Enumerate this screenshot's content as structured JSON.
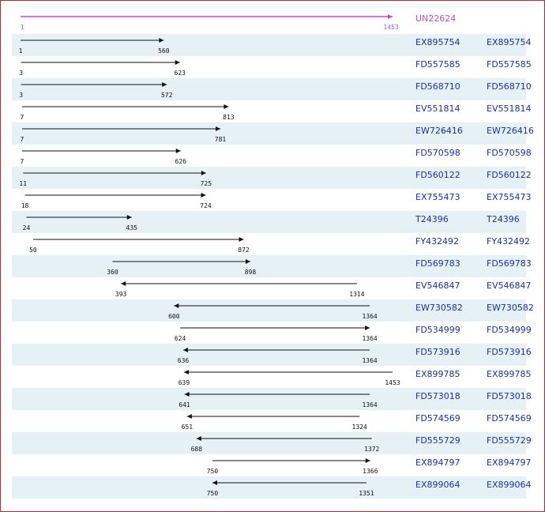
{
  "query": {
    "id": "UN22624",
    "start": 1,
    "end": 1453,
    "strand": "+"
  },
  "colors": {
    "query_line": "#c44cc4",
    "hit_line": "#111111",
    "id_text": "#1a2fb0",
    "row_band": "#e6f1f5",
    "border": "#c0272d"
  },
  "hits": [
    {
      "id": "EX895754",
      "start": 1,
      "end": 560,
      "strand": "+"
    },
    {
      "id": "FD557585",
      "start": 3,
      "end": 623,
      "strand": "+"
    },
    {
      "id": "FD568710",
      "start": 3,
      "end": 572,
      "strand": "+"
    },
    {
      "id": "EV551814",
      "start": 7,
      "end": 813,
      "strand": "+"
    },
    {
      "id": "EW726416",
      "start": 7,
      "end": 781,
      "strand": "+"
    },
    {
      "id": "FD570598",
      "start": 7,
      "end": 626,
      "strand": "+"
    },
    {
      "id": "FD560122",
      "start": 11,
      "end": 725,
      "strand": "+"
    },
    {
      "id": "EX755473",
      "start": 18,
      "end": 724,
      "strand": "+"
    },
    {
      "id": "T24396",
      "start": 24,
      "end": 435,
      "strand": "+"
    },
    {
      "id": "FY432492",
      "start": 50,
      "end": 872,
      "strand": "+"
    },
    {
      "id": "FD569783",
      "start": 360,
      "end": 898,
      "strand": "+"
    },
    {
      "id": "EV546847",
      "start": 393,
      "end": 1314,
      "strand": "-"
    },
    {
      "id": "EW730582",
      "start": 600,
      "end": 1364,
      "strand": "-"
    },
    {
      "id": "FD534999",
      "start": 624,
      "end": 1364,
      "strand": "+"
    },
    {
      "id": "FD573916",
      "start": 636,
      "end": 1364,
      "strand": "-"
    },
    {
      "id": "EX899785",
      "start": 639,
      "end": 1453,
      "strand": "-"
    },
    {
      "id": "FD573018",
      "start": 641,
      "end": 1364,
      "strand": "-"
    },
    {
      "id": "FD574569",
      "start": 651,
      "end": 1324,
      "strand": "-"
    },
    {
      "id": "FD555729",
      "start": 688,
      "end": 1372,
      "strand": "-"
    },
    {
      "id": "EX894797",
      "start": 750,
      "end": 1366,
      "strand": "+"
    },
    {
      "id": "EX899064",
      "start": 750,
      "end": 1351,
      "strand": "-"
    }
  ]
}
